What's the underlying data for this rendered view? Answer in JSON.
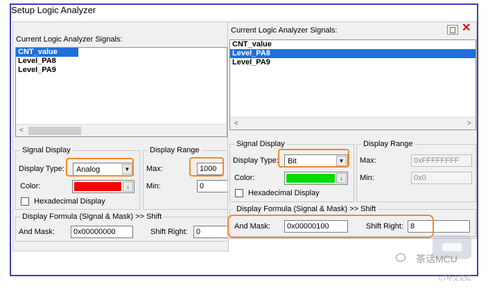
{
  "window": {
    "title": "Setup Logic Analyzer"
  },
  "left": {
    "signals_label": "Current Logic Analyzer Signals:",
    "signals": [
      {
        "name": "CNT_value",
        "selected": true
      },
      {
        "name": "Level_PA8",
        "selected": false
      },
      {
        "name": "Level_PA9",
        "selected": false
      }
    ],
    "scroll_left": "<",
    "signal_display": {
      "title": "Signal Display",
      "display_type_label": "Display Type:",
      "display_type_value": "Analog",
      "color_label": "Color:",
      "color": "#ff0000",
      "hex_label": "Hexadecimal Display"
    },
    "display_range": {
      "title": "Display Range",
      "max_label": "Max:",
      "max_value": "1000",
      "min_label": "Min:",
      "min_value": "0"
    },
    "formula": {
      "title": "Display Formula (Signal & Mask) >> Shift",
      "and_mask_label": "And Mask:",
      "and_mask_value": "0x00000000",
      "shift_label": "Shift Right:",
      "shift_value": "0"
    }
  },
  "right": {
    "signals_label": "Current Logic Analyzer Signals:",
    "signals": [
      {
        "name": "CNT_value",
        "selected": false
      },
      {
        "name": "Level_PA8",
        "selected": true
      },
      {
        "name": "Level_PA9",
        "selected": false
      }
    ],
    "scroll_left": "<",
    "scroll_right": ">",
    "signal_display": {
      "title": "Signal Display",
      "display_type_label": "Display Type:",
      "display_type_value": "Bit",
      "color_label": "Color:",
      "color": "#00dd00",
      "hex_label": "Hexadecimal Display"
    },
    "display_range": {
      "title": "Display Range",
      "max_label": "Max:",
      "max_value": "0xFFFFFFFF",
      "min_label": "Min:",
      "min_value": "0x0"
    },
    "formula": {
      "title": "Display Formula (Signal & Mask) >> Shift",
      "and_mask_label": "And Mask:",
      "and_mask_value": "0x00000100",
      "shift_label": "Shift Right:",
      "shift_value": "8"
    }
  },
  "watermark": {
    "text": "茶话MCU",
    "sub": "CT中文论坛"
  },
  "colors": {
    "highlight": "#ef8a2a",
    "selection": "#1e6fd9",
    "frame": "#3b3fa8"
  }
}
